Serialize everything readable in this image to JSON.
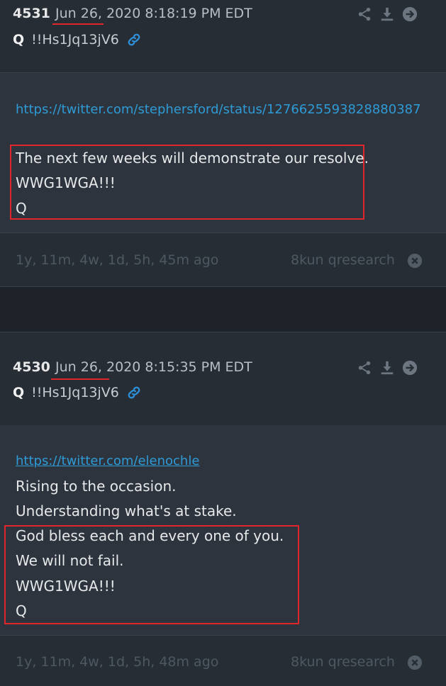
{
  "posts": [
    {
      "number": "4531",
      "date": "Jun 26, 2020 8:18:19 PM EDT",
      "author_name": "Q",
      "tripcode": "!!Hs1Jq13jV6",
      "link": "https://twitter.com/stephersford/status/1276625593828880387",
      "lines": [
        "The next few weeks will demonstrate our resolve.",
        "WWG1WGA!!!",
        "Q"
      ],
      "ago": "1y, 11m, 4w, 1d, 5h, 45m ago",
      "source": "8kun qresearch"
    },
    {
      "number": "4530",
      "date": "Jun 26, 2020 8:15:35 PM EDT",
      "author_name": "Q",
      "tripcode": "!!Hs1Jq13jV6",
      "link": "https://twitter.com/elenochle",
      "lines": [
        "Rising to the occasion.",
        "Understanding what's at stake.",
        "God bless each and every one of you.",
        "We will not fail.",
        "WWG1WGA!!!",
        "Q"
      ],
      "ago": "1y, 11m, 4w, 1d, 5h, 48m ago",
      "source": "8kun qresearch"
    }
  ],
  "colors": {
    "background": "#1e232a",
    "link": "#2e9bd6",
    "highlight": "#e0262a",
    "muted": "#4d5862"
  },
  "icons": [
    "share-icon",
    "download-icon",
    "arrow-right-icon",
    "chain-link-icon",
    "close-circle-icon"
  ]
}
